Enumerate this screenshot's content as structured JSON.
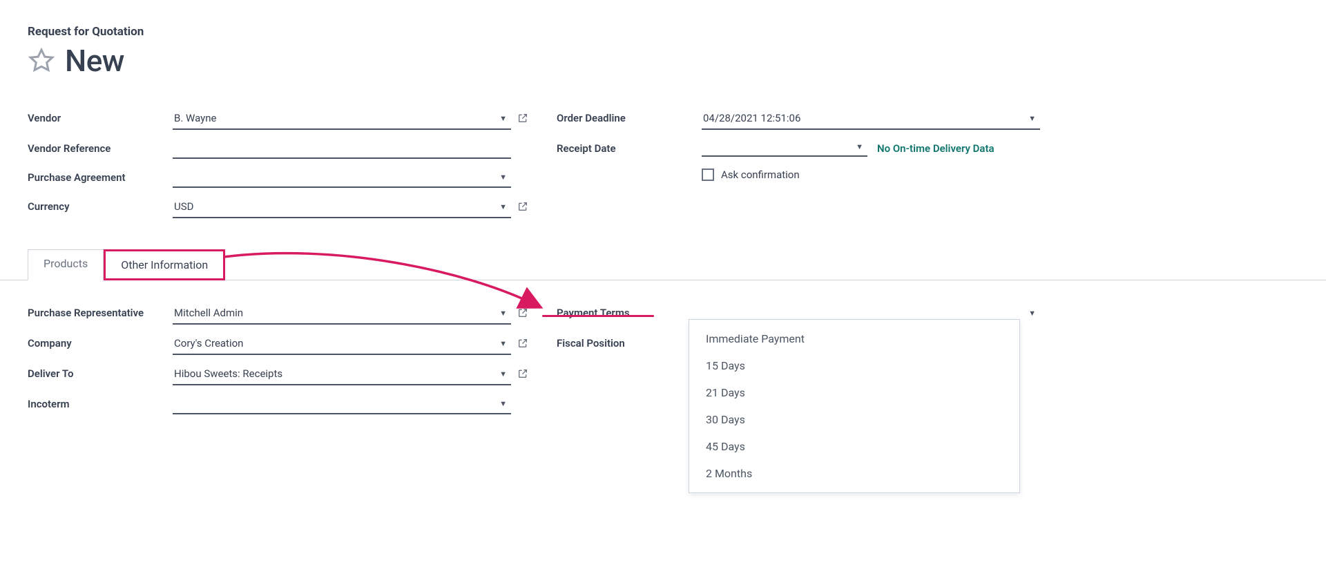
{
  "breadcrumb": "Request for Quotation",
  "title": "New",
  "left_fields": {
    "vendor": {
      "label": "Vendor",
      "value": "B. Wayne"
    },
    "vendor_ref": {
      "label": "Vendor Reference",
      "value": ""
    },
    "purchase_agreement": {
      "label": "Purchase Agreement",
      "value": ""
    },
    "currency": {
      "label": "Currency",
      "value": "USD"
    }
  },
  "right_fields": {
    "order_deadline": {
      "label": "Order Deadline",
      "value": "04/28/2021 12:51:06"
    },
    "receipt_date": {
      "label": "Receipt Date",
      "value": "",
      "hint": "No On-time Delivery Data"
    },
    "ask_confirmation": {
      "label": "Ask confirmation"
    }
  },
  "tabs": {
    "products": "Products",
    "other_info": "Other Information"
  },
  "other_info_left": {
    "purchase_rep": {
      "label": "Purchase Representative",
      "value": "Mitchell Admin"
    },
    "company": {
      "label": "Company",
      "value": "Cory's Creation"
    },
    "deliver_to": {
      "label": "Deliver To",
      "value": "Hibou Sweets: Receipts"
    },
    "incoterm": {
      "label": "Incoterm",
      "value": ""
    }
  },
  "other_info_right": {
    "payment_terms": {
      "label": "Payment Terms"
    },
    "fiscal_position": {
      "label": "Fiscal Position"
    }
  },
  "payment_terms_options": [
    "Immediate Payment",
    "15 Days",
    "21 Days",
    "30 Days",
    "45 Days",
    "2 Months"
  ]
}
